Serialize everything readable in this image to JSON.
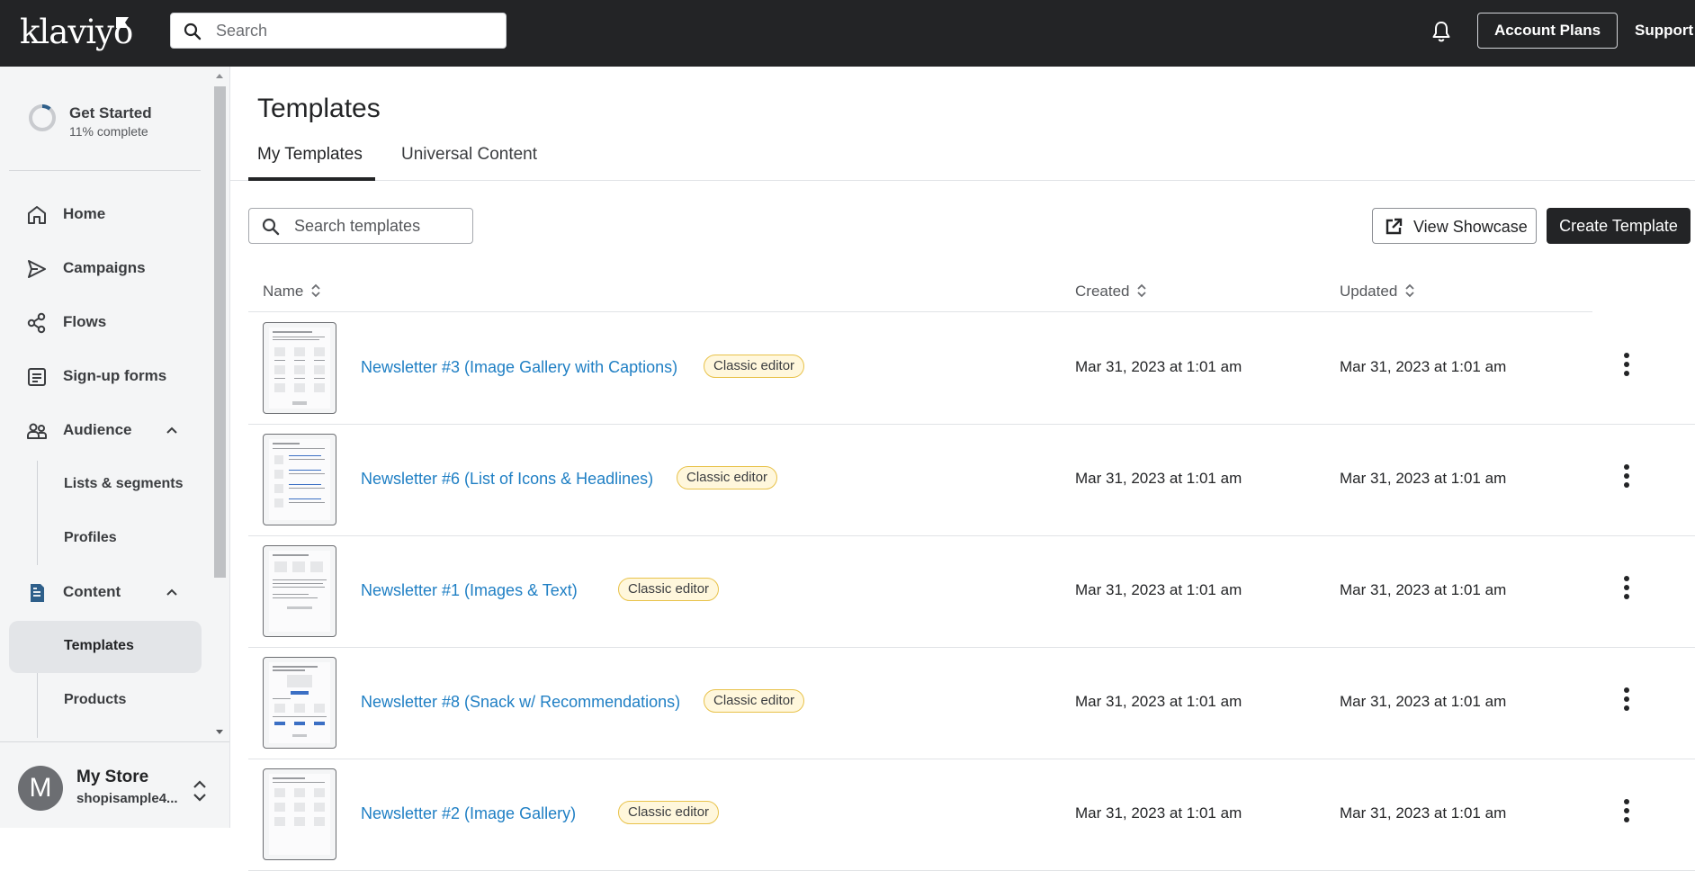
{
  "header": {
    "logo": "klaviyo",
    "search_placeholder": "Search",
    "account_plans_label": "Account Plans",
    "support_label": "Support"
  },
  "sidebar": {
    "get_started": {
      "title": "Get Started",
      "progress_text": "11% complete",
      "progress": 0.11
    },
    "nav": {
      "home": "Home",
      "campaigns": "Campaigns",
      "flows": "Flows",
      "signup_forms": "Sign-up forms",
      "audience": "Audience",
      "lists_segments": "Lists & segments",
      "profiles": "Profiles",
      "content": "Content",
      "templates": "Templates",
      "products": "Products"
    },
    "store": {
      "avatar_letter": "M",
      "name": "My Store",
      "subtitle": "shopisample4..."
    }
  },
  "main": {
    "title": "Templates",
    "tabs": [
      "My Templates",
      "Universal Content"
    ],
    "active_tab": "My Templates",
    "search_placeholder": "Search templates",
    "view_showcase_label": "View Showcase",
    "create_template_label": "Create Template",
    "columns": {
      "name": "Name",
      "created": "Created",
      "updated": "Updated"
    },
    "rows": [
      {
        "name": "Newsletter #3 (Image Gallery with Captions)",
        "badge": "Classic editor",
        "created": "Mar 31, 2023 at 1:01 am",
        "updated": "Mar 31, 2023 at 1:01 am"
      },
      {
        "name": "Newsletter #6 (List of Icons & Headlines)",
        "badge": "Classic editor",
        "created": "Mar 31, 2023 at 1:01 am",
        "updated": "Mar 31, 2023 at 1:01 am"
      },
      {
        "name": "Newsletter #1 (Images & Text)",
        "badge": "Classic editor",
        "created": "Mar 31, 2023 at 1:01 am",
        "updated": "Mar 31, 2023 at 1:01 am"
      },
      {
        "name": "Newsletter #8 (Snack w/ Recommendations)",
        "badge": "Classic editor",
        "created": "Mar 31, 2023 at 1:01 am",
        "updated": "Mar 31, 2023 at 1:01 am"
      },
      {
        "name": "Newsletter #2 (Image Gallery)",
        "badge": "Classic editor",
        "created": "Mar 31, 2023 at 1:01 am",
        "updated": "Mar 31, 2023 at 1:01 am"
      }
    ]
  },
  "colors": {
    "topbar": "#232426",
    "link": "#1f7fc4",
    "badge_border": "#e8c24a",
    "badge_bg": "#fff7dc",
    "sidebar_bg": "#f4f5f6",
    "progress_accent": "#2e5f8a"
  },
  "icons": [
    "search-icon",
    "bell-icon",
    "home-icon",
    "send-icon",
    "flows-icon",
    "form-icon",
    "audience-icon",
    "content-icon",
    "chevron-up-icon",
    "external-link-icon",
    "sort-icon",
    "kebab-icon"
  ]
}
